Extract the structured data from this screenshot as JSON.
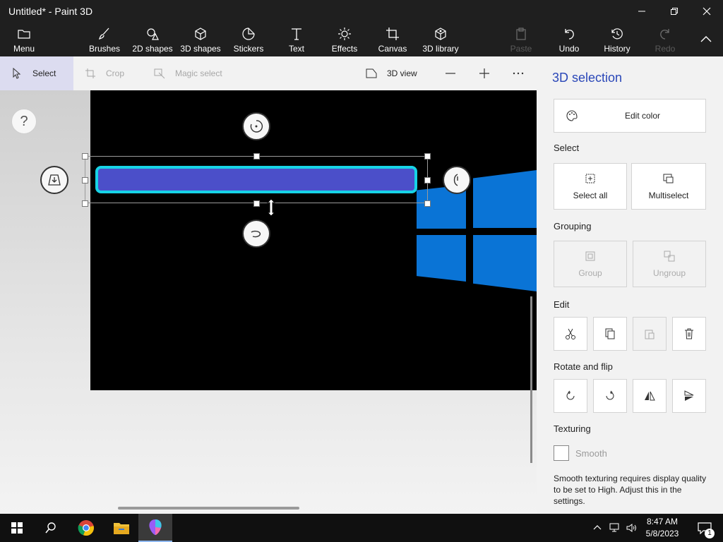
{
  "window": {
    "title": "Untitled* - Paint 3D"
  },
  "ribbon": {
    "menu": "Menu",
    "brushes": "Brushes",
    "shapes2d": "2D shapes",
    "shapes3d": "3D shapes",
    "stickers": "Stickers",
    "text": "Text",
    "effects": "Effects",
    "canvas": "Canvas",
    "library3d": "3D library",
    "paste": "Paste",
    "undo": "Undo",
    "history": "History",
    "redo": "Redo"
  },
  "toolbar": {
    "select": "Select",
    "crop": "Crop",
    "magic_select": "Magic select",
    "view3d": "3D view"
  },
  "workspace": {
    "help": "?"
  },
  "panel": {
    "title": "3D selection",
    "edit_color": "Edit color",
    "select_section": "Select",
    "select_all": "Select all",
    "multiselect": "Multiselect",
    "grouping_section": "Grouping",
    "group": "Group",
    "ungroup": "Ungroup",
    "edit_section": "Edit",
    "rotate_section": "Rotate and flip",
    "texturing_section": "Texturing",
    "smooth": "Smooth",
    "note": "Smooth texturing requires display quality to be set to High. Adjust this in the settings."
  },
  "taskbar": {
    "time": "8:47 AM",
    "date": "5/8/2023",
    "notification_count": "1"
  },
  "colors": {
    "accent": "#2a47b8",
    "selected_shape_fill": "#4b4fc9",
    "selected_shape_border": "#17d3e6",
    "windows_blue": "#0a74d6"
  }
}
